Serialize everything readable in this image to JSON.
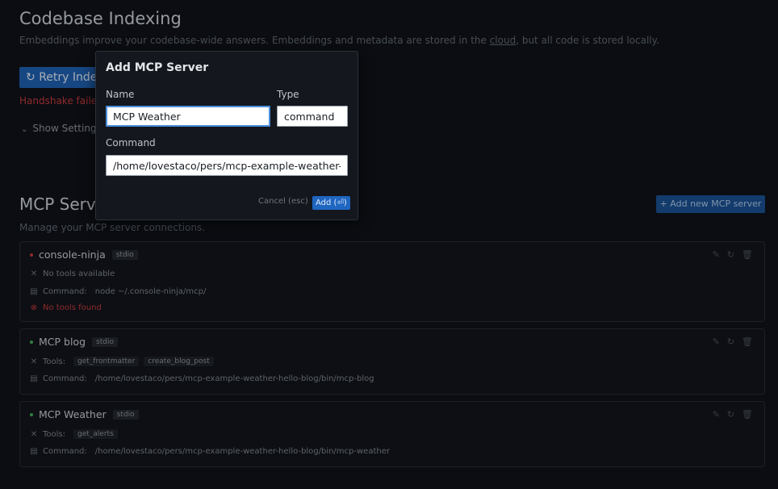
{
  "indexing": {
    "title": "Codebase Indexing",
    "description_prefix": "Embeddings improve your codebase-wide answers. Embeddings and metadata are stored in the ",
    "description_link": "cloud",
    "description_suffix": ", but all code is stored locally.",
    "retry_button": "Retry Indexing",
    "error_text": "Handshake failed",
    "show_settings": "Show Settings"
  },
  "mcp": {
    "title": "MCP Servers",
    "description": "Manage your MCP server connections.",
    "add_new_button": "+ Add new MCP server",
    "servers": [
      {
        "name": "console-ninja",
        "type_badge": "stdio",
        "status_color": "#c0393b",
        "tools_text": "No tools available",
        "command_label": "Command:",
        "command": "node ~/.console-ninja/mcp/",
        "error": "No tools found"
      },
      {
        "name": "MCP blog",
        "type_badge": "stdio",
        "status_color": "#3fae52",
        "tools_label": "Tools:",
        "tools": [
          "get_frontmatter",
          "create_blog_post"
        ],
        "command_label": "Command:",
        "command": "/home/lovestaco/pers/mcp-example-weather-hello-blog/bin/mcp-blog"
      },
      {
        "name": "MCP Weather",
        "type_badge": "stdio",
        "status_color": "#3fae52",
        "tools_label": "Tools:",
        "tools": [
          "get_alerts"
        ],
        "command_label": "Command:",
        "command": "/home/lovestaco/pers/mcp-example-weather-hello-blog/bin/mcp-weather"
      }
    ]
  },
  "modal": {
    "title": "Add MCP Server",
    "name_label": "Name",
    "name_value": "MCP Weather",
    "type_label": "Type",
    "type_value": "command",
    "command_label": "Command",
    "command_value": "/home/lovestaco/pers/mcp-example-weather-hello-blog/bin/mcp-weather",
    "cancel": "Cancel (esc)",
    "add": "Add (⏎)"
  },
  "icons": {
    "retry": "refresh-icon",
    "chevron": "chevron-down-icon",
    "tools": "tools-icon",
    "command": "terminal-icon",
    "error": "error-circle-icon",
    "edit": "edit-icon",
    "refresh": "refresh-icon",
    "delete": "trash-icon"
  }
}
